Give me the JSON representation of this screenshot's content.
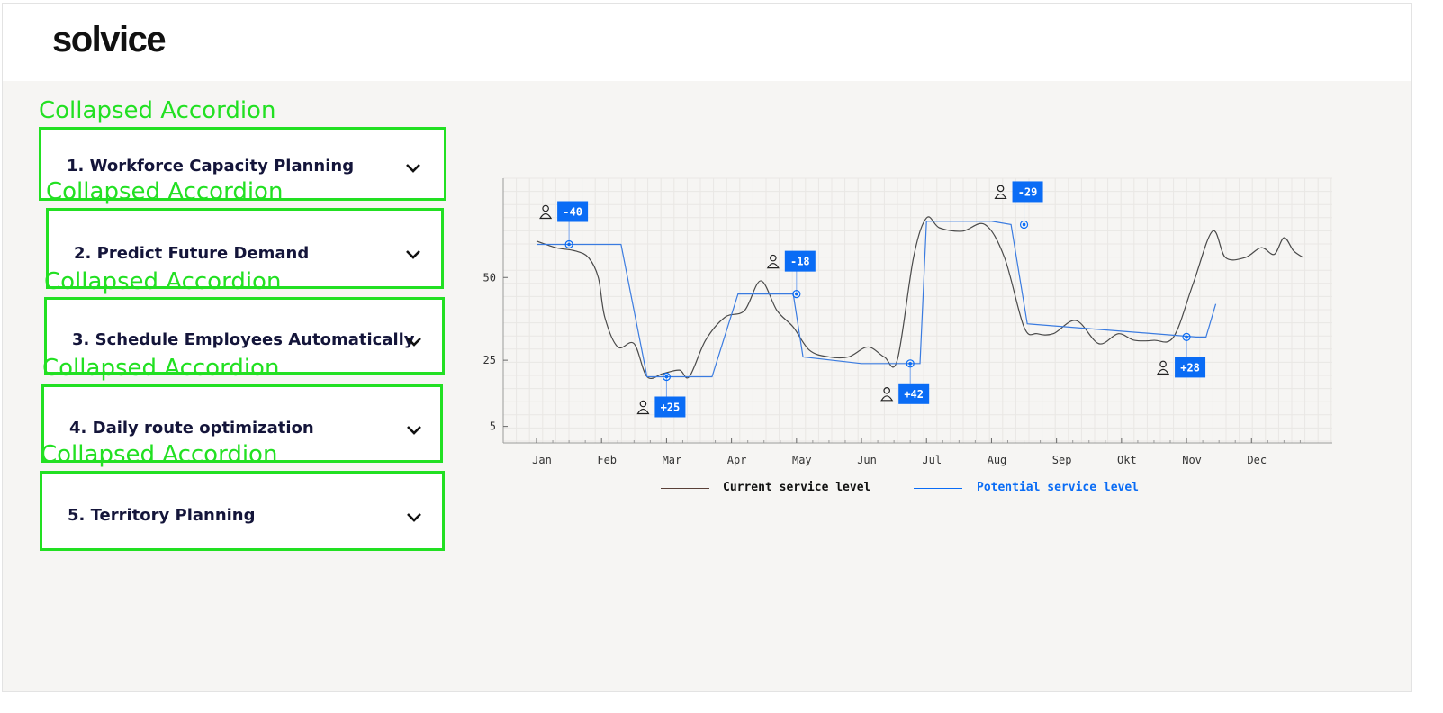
{
  "brand": {
    "logo_text": "solvice"
  },
  "annotation_label": "Collapsed Accordion",
  "accordions": [
    {
      "title": "1. Workforce Capacity Planning",
      "expanded": false
    },
    {
      "title": "2. Predict Future Demand",
      "expanded": false
    },
    {
      "title": "3. Schedule Employees Automatically",
      "expanded": false
    },
    {
      "title": "4. Daily route optimization",
      "expanded": false
    },
    {
      "title": "5. Territory Planning",
      "expanded": false
    }
  ],
  "colors": {
    "accent": "#0a6cf5",
    "annotation": "#22e022",
    "current_line": "#4a4a4a",
    "background": "#f6f5f3"
  },
  "chart_data": {
    "type": "line",
    "title": "",
    "xlabel": "",
    "ylabel": "",
    "categories": [
      "Jan",
      "Feb",
      "Mar",
      "Apr",
      "May",
      "Jun",
      "Jul",
      "Aug",
      "Sep",
      "Okt",
      "Nov",
      "Dec"
    ],
    "y_ticks": [
      5,
      25,
      50
    ],
    "ylim": [
      0,
      80
    ],
    "grid": true,
    "legend": "bottom",
    "series": [
      {
        "name": "Current service level",
        "x": [
          0.0,
          0.3,
          0.6,
          0.8,
          0.95,
          1.05,
          1.25,
          1.5,
          1.7,
          1.95,
          2.2,
          2.35,
          2.6,
          2.9,
          3.2,
          3.45,
          3.7,
          3.95,
          4.2,
          4.5,
          4.8,
          5.1,
          5.35,
          5.55,
          5.8,
          6.0,
          6.2,
          6.55,
          6.9,
          7.2,
          7.5,
          7.7,
          7.95,
          8.3,
          8.65,
          8.95,
          9.2,
          9.5,
          9.8,
          10.1,
          10.4,
          10.6,
          10.9,
          11.15,
          11.35,
          11.5,
          11.65,
          11.8
        ],
        "values": [
          61,
          59,
          58,
          56,
          50,
          38,
          29,
          30,
          20,
          21,
          22,
          20,
          31,
          38,
          40,
          49,
          40,
          35,
          28,
          26,
          26,
          29,
          26,
          25,
          56,
          68,
          65,
          64,
          66,
          56,
          35,
          33,
          33,
          37,
          30,
          33,
          31,
          31,
          32,
          48,
          64,
          56,
          56,
          59,
          57,
          62,
          58,
          56
        ]
      },
      {
        "name": "Potential service level",
        "x": [
          0.0,
          0.5,
          1.0,
          1.3,
          1.7,
          2.2,
          2.5,
          2.7,
          3.1,
          3.5,
          3.95,
          4.1,
          5.0,
          5.4,
          5.9,
          6.0,
          7.0,
          7.3,
          7.55,
          10.15,
          10.3,
          10.45
        ],
        "values": [
          60,
          60,
          60,
          60,
          20,
          20,
          20,
          20,
          45,
          45,
          45,
          26,
          24,
          24,
          24,
          67,
          67,
          66,
          36,
          32,
          32,
          42
        ]
      }
    ],
    "annotations": [
      {
        "label": "-40",
        "x": 0.5,
        "y": 60,
        "position": "above"
      },
      {
        "label": "+25",
        "x": 2.0,
        "y": 20,
        "position": "below"
      },
      {
        "label": "-18",
        "x": 4.0,
        "y": 45,
        "position": "above"
      },
      {
        "label": "+42",
        "x": 5.75,
        "y": 24,
        "position": "below"
      },
      {
        "label": "-29",
        "x": 7.5,
        "y": 66,
        "position": "above"
      },
      {
        "label": "+28",
        "x": 10.0,
        "y": 32,
        "position": "below"
      }
    ]
  }
}
